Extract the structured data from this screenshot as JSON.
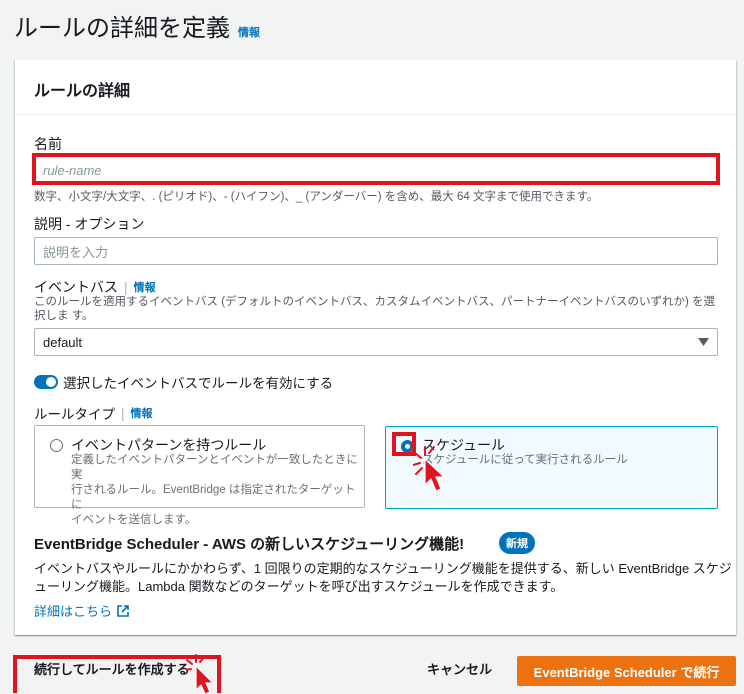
{
  "page": {
    "title": "ルールの詳細を定義",
    "info": "情報"
  },
  "card": {
    "header": "ルールの詳細"
  },
  "name_field": {
    "label": "名前",
    "placeholder": "rule-name",
    "hint": "数字、小文字/大文字、. (ピリオド)、- (ハイフン)、_ (アンダーバー) を含め、最大 64 文字まで使用できます。"
  },
  "description_field": {
    "label": "説明 - オプション",
    "placeholder": "説明を入力"
  },
  "event_bus": {
    "label": "イベントバス",
    "info": "情報",
    "hint": "このルールを適用するイベントバス (デフォルトのイベントバス、カスタムイベントバス、パートナーイベントバスのいずれか) を選択しま す。",
    "selected": "default"
  },
  "enable_toggle": {
    "label": "選択したイベントバスでルールを有効にする",
    "enabled": true
  },
  "rule_type": {
    "label": "ルールタイプ",
    "info": "情報",
    "options": [
      {
        "title": "イベントパターンを持つルール",
        "desc_line1": "定義したイベントパターンとイベントが一致したときに実",
        "desc_line2": "行されるルール。EventBridge は指定されたターゲットに",
        "desc_line3": "イベントを送信します。",
        "selected": false
      },
      {
        "title": "スケジュール",
        "desc_line1": "スケジュールに従って実行されるルール",
        "selected": true
      }
    ]
  },
  "scheduler_notice": {
    "title": "EventBridge Scheduler - AWS の新しいスケジューリング機能!",
    "badge": "新規",
    "body_line1": "イベントバスやルールにかかわらず、1 回限りの定期的なスケジューリング機能を提供する、新しい EventBridge スケジ",
    "body_line2": "ューリング機能。Lambda 関数などのターゲットを呼び出すスケジュールを作成できます。",
    "link": "詳細はこちら"
  },
  "footer": {
    "continue_label": "続行してルールを作成する",
    "cancel_label": "キャンセル",
    "scheduler_label": "EventBridge Scheduler で続行"
  },
  "colors": {
    "accent": "#0073bb",
    "primary_button": "#ec7211",
    "highlight": "#e0141e"
  }
}
